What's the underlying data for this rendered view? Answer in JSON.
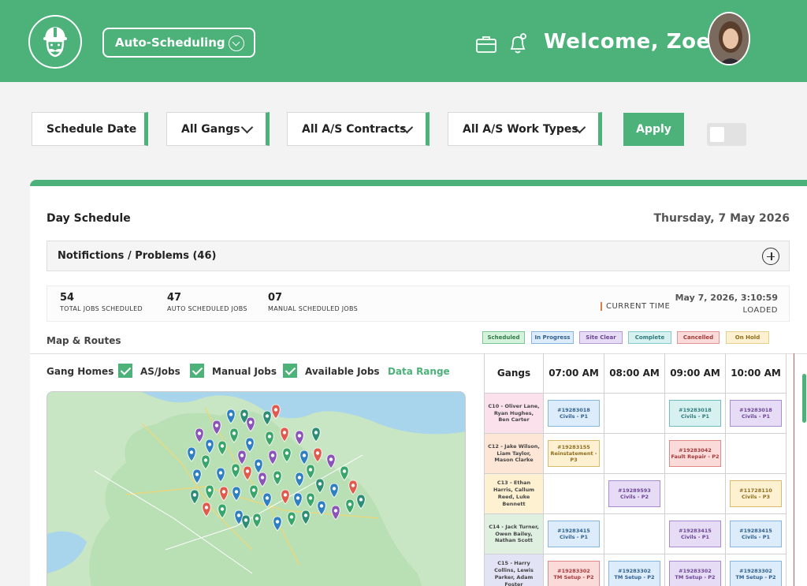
{
  "header": {
    "module_label": "Auto-Scheduling",
    "welcome": "Welcome, Zoe!",
    "icons": {
      "logo": "worker-mascot-icon",
      "briefcase": "briefcase-icon",
      "alert": "bell-alert-icon",
      "avatar": "user-avatar"
    }
  },
  "filters": {
    "schedule_date": "Schedule Date",
    "gangs": "All Gangs",
    "contracts": "All A/S Contracts",
    "work_types": "All A/S Work Types",
    "apply": "Apply"
  },
  "panel": {
    "title": "Day Schedule",
    "date": "Thursday, 7 May 2026",
    "notifications": "Notifictions / Problems (46)"
  },
  "stats": {
    "total": {
      "num": "54",
      "label": "TOTAL JOBS SCHEDULED"
    },
    "auto": {
      "num": "47",
      "label": "AUTO SCHEDULED JOBS"
    },
    "manual": {
      "num": "07",
      "label": "MANUAL SCHEDULED JOBS"
    },
    "current_time_label": "CURRENT TIME",
    "current_time": "May 7, 2026, 3:10:59",
    "loaded": "LOADED"
  },
  "map_routes_label": "Map & Routes",
  "legend": [
    {
      "label": "Scheduled",
      "bg": "#d4f2dc",
      "border": "#7bc793",
      "color": "#2f7a47"
    },
    {
      "label": "In Progress",
      "bg": "#dcecfa",
      "border": "#86b6e0",
      "color": "#2f5f8e"
    },
    {
      "label": "Site Clear",
      "bg": "#e7dcf5",
      "border": "#b59ad8",
      "color": "#6b4595"
    },
    {
      "label": "Complete",
      "bg": "#d7f0f0",
      "border": "#85c9c9",
      "color": "#2f7a7a"
    },
    {
      "label": "Cancelled",
      "bg": "#fbdada",
      "border": "#e49393",
      "color": "#a53838"
    },
    {
      "label": "On Hold",
      "bg": "#fdf1d2",
      "border": "#e8cf8a",
      "color": "#8f6d1d"
    }
  ],
  "map_controls": {
    "gang_homes": "Gang Homes",
    "as_jobs": "AS/Jobs",
    "manual_jobs": "Manual Jobs",
    "available_jobs": "Available Jobs",
    "data_range": "Data Range"
  },
  "grid": {
    "gangs_header": "Gangs",
    "times": [
      "07:00 AM",
      "08:00 AM",
      "09:00 AM",
      "10:00 AM"
    ],
    "rows": [
      {
        "gang": "C10 - Oliver Lane, Ryan Hughes, Ben Carter",
        "bg": "#fbe1ec",
        "slots": [
          {
            "id": "#19283018",
            "type": "Civils - P1",
            "status": "progress"
          },
          null,
          {
            "id": "#19283018",
            "type": "Civils - P1",
            "status": "complete"
          },
          {
            "id": "#19283018",
            "type": "Civils - P1",
            "status": "site"
          }
        ]
      },
      {
        "gang": "C12 - Jake Wilson, Liam Taylor, Mason Clarke",
        "bg": "#fde6d6",
        "slots": [
          {
            "id": "#19283155",
            "type": "Reinstatement - P3",
            "status": "hold"
          },
          null,
          {
            "id": "#19283042",
            "type": "Fault Repair - P2",
            "status": "cancel"
          },
          null
        ]
      },
      {
        "gang": "C13 - Ethan Harris, Callum Reed, Luke Bennett",
        "bg": "#fdf1d2",
        "slots": [
          null,
          {
            "id": "#19289593",
            "type": "Civils - P2",
            "status": "site"
          },
          null,
          {
            "id": "#11728110",
            "type": "Civils - P3",
            "status": "hold"
          }
        ]
      },
      {
        "gang": "C14 - Jack Turner, Owen Bailey, Nathan Scott",
        "bg": "#dff0e1",
        "slots": [
          {
            "id": "#19283415",
            "type": "Civils - P1",
            "status": "progress"
          },
          null,
          {
            "id": "#19283415",
            "type": "Civils - P1",
            "status": "site"
          },
          {
            "id": "#19283415",
            "type": "Civils - P1",
            "status": "progress"
          }
        ]
      },
      {
        "gang": "C15 - Harry Collins, Lewis Parker, Adam Foster",
        "bg": "#e2e4f5",
        "slots": [
          {
            "id": "#19283302",
            "type": "TM Setup - P2",
            "status": "cancel"
          },
          {
            "id": "#19283302",
            "type": "TM Setup - P2",
            "status": "progress"
          },
          {
            "id": "#19283302",
            "type": "TM Setup - P2",
            "status": "site"
          },
          {
            "id": "#19283302",
            "type": "TM Setup - P2",
            "status": "progress"
          }
        ]
      }
    ]
  },
  "status_colors": {
    "progress": {
      "bg": "#dcecfa",
      "border": "#86b6e0",
      "color": "#2f5f8e"
    },
    "complete": {
      "bg": "#d7f0f0",
      "border": "#6fbcbc",
      "color": "#2f7a7a"
    },
    "site": {
      "bg": "#e7dcf5",
      "border": "#a88bd0",
      "color": "#6b4595"
    },
    "hold": {
      "bg": "#fdf1d2",
      "border": "#d9bb6c",
      "color": "#8f6d1d"
    },
    "cancel": {
      "bg": "#fbdada",
      "border": "#e08888",
      "color": "#a53838"
    }
  },
  "colors": {
    "brand": "#4cb27a",
    "pin_green": "#3aa56b",
    "pin_blue": "#2f7fc1",
    "pin_red": "#e05a4e",
    "pin_purple": "#8b55b8",
    "pin_teal": "#2e8d74"
  }
}
